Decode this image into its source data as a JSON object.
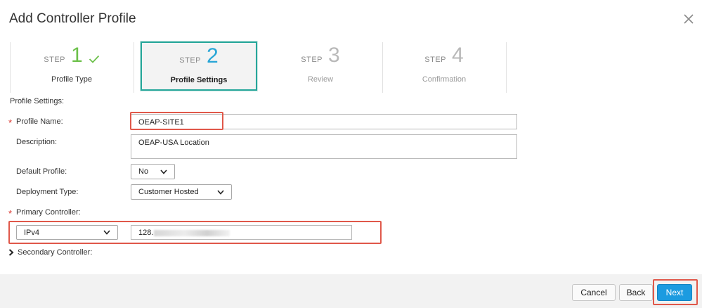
{
  "dialog": {
    "title": "Add Controller Profile"
  },
  "steps": [
    {
      "word": "STEP",
      "number": "1",
      "label": "Profile Type",
      "status": "complete"
    },
    {
      "word": "STEP",
      "number": "2",
      "label": "Profile Settings",
      "status": "active"
    },
    {
      "word": "STEP",
      "number": "3",
      "label": "Review",
      "status": "pending"
    },
    {
      "word": "STEP",
      "number": "4",
      "label": "Confirmation",
      "status": "pending"
    }
  ],
  "form": {
    "section_label": "Profile Settings:",
    "profile_name": {
      "label": "Profile Name:",
      "value": "OEAP-SITE1",
      "required": "*"
    },
    "description": {
      "label": "Description:",
      "value": "OEAP-USA Location"
    },
    "default_profile": {
      "label": "Default Profile:",
      "value": "No"
    },
    "deployment_type": {
      "label": "Deployment Type:",
      "value": "Customer Hosted"
    },
    "primary_controller": {
      "label": "Primary Controller:",
      "required": "*",
      "ip_type": "IPv4",
      "ip_value": "128."
    },
    "secondary_controller": {
      "label": "Secondary Controller:"
    }
  },
  "buttons": {
    "cancel": "Cancel",
    "back": "Back",
    "next": "Next"
  },
  "colors": {
    "accent": "#1c9be0",
    "complete": "#6cc04a",
    "active_border": "#26a69a",
    "highlight": "#e0584a",
    "required": "#d9332b"
  },
  "icons": {
    "close": "close-icon",
    "check": "check-icon",
    "chevron": "chevron-down-icon",
    "caret": "caret-right-icon"
  }
}
